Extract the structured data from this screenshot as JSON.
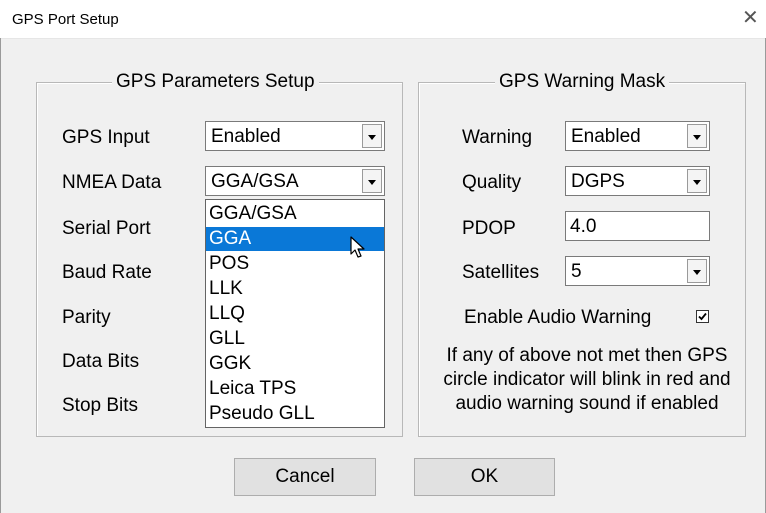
{
  "window": {
    "title": "GPS Port Setup",
    "close_symbol": "✕"
  },
  "gps_params": {
    "title": "GPS Parameters Setup",
    "gps_input_label": "GPS Input",
    "gps_input_value": "Enabled",
    "nmea_label": "NMEA Data",
    "nmea_value": "GGA/GSA",
    "serial_port_label": "Serial Port",
    "baud_rate_label": "Baud Rate",
    "parity_label": "Parity",
    "data_bits_label": "Data Bits",
    "stop_bits_label": "Stop Bits",
    "nmea_options": [
      "GGA/GSA",
      "GGA",
      "POS",
      "LLK",
      "LLQ",
      "GLL",
      "GGK",
      "Leica TPS",
      "Pseudo GLL"
    ],
    "nmea_highlighted": "GGA"
  },
  "warning_mask": {
    "title": "GPS Warning Mask",
    "warning_label": "Warning",
    "warning_value": "Enabled",
    "quality_label": "Quality",
    "quality_value": "DGPS",
    "pdop_label": "PDOP",
    "pdop_value": "4.0",
    "satellites_label": "Satellites",
    "satellites_value": "5",
    "audio_label": "Enable Audio Warning",
    "audio_checked": true,
    "note_lines": [
      "If any of above not met then GPS",
      "circle indicator will blink in red and",
      "audio warning sound if enabled"
    ]
  },
  "buttons": {
    "cancel": "Cancel",
    "ok": "OK"
  },
  "colors": {
    "selection": "#0a78d7",
    "window_bg": "#f0f0f0"
  }
}
